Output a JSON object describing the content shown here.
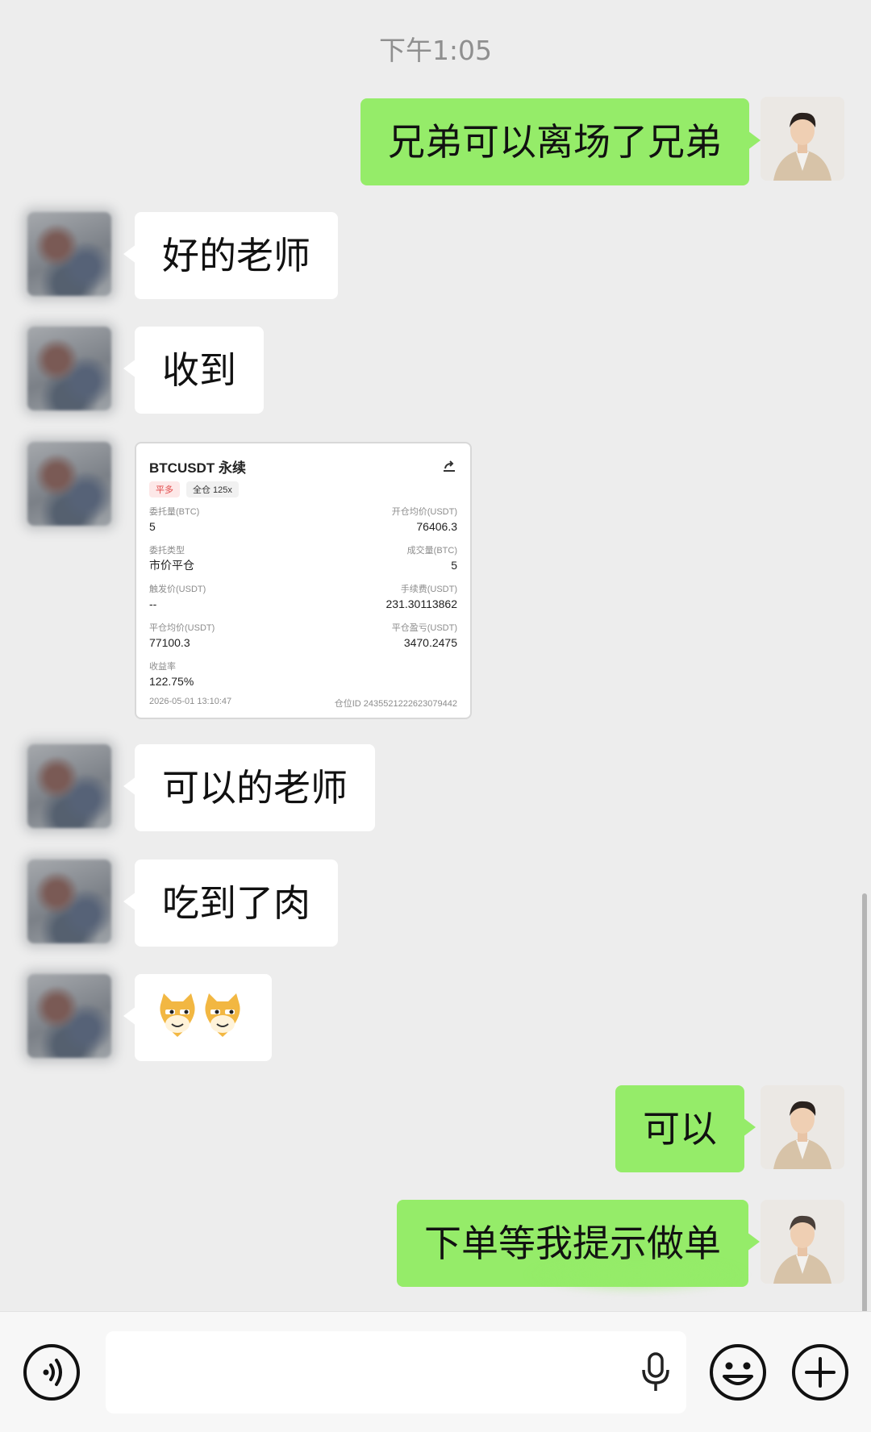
{
  "chat": {
    "timestamp": "下午1:05",
    "messages": [
      {
        "from": "me",
        "text": "兄弟可以离场了兄弟"
      },
      {
        "from": "them",
        "text": "好的老师"
      },
      {
        "from": "them",
        "text": "收到"
      },
      {
        "from": "them",
        "text": "order-card"
      },
      {
        "from": "them",
        "text": "可以的老师"
      },
      {
        "from": "them",
        "text": "吃到了肉"
      },
      {
        "from": "them",
        "text": "🐱🐱"
      },
      {
        "from": "me",
        "text": "可以"
      },
      {
        "from": "me",
        "text": "下单等我提示做单"
      }
    ]
  },
  "card": {
    "title": "BTCUSDT 永续",
    "tag1": "平多",
    "tag2": "全仓 125x",
    "rows": [
      {
        "l_label": "委托量(BTC)",
        "l_value": "5",
        "r_label": "开仓均价(USDT)",
        "r_value": "76406.3"
      },
      {
        "l_label": "委托类型",
        "l_value": "市价平仓",
        "r_label": "成交量(BTC)",
        "r_value": "5"
      },
      {
        "l_label": "触发价(USDT)",
        "l_value": "--",
        "r_label": "手续费(USDT)",
        "r_value": "231.30113862"
      },
      {
        "l_label": "平仓均价(USDT)",
        "l_value": "77100.3",
        "r_label": "平仓盈亏(USDT)",
        "r_value": "3470.2475"
      },
      {
        "l_label": "收益率",
        "l_value": "122.75%",
        "r_label": "",
        "r_value": ""
      }
    ],
    "footer_time": "2026-05-01 13:10:47",
    "footer_id": "仓位ID 2435521222623079442"
  },
  "icons": {
    "voice": "voice-icon",
    "mic": "microphone-icon",
    "emoji": "emoji-icon",
    "plus": "plus-icon"
  }
}
